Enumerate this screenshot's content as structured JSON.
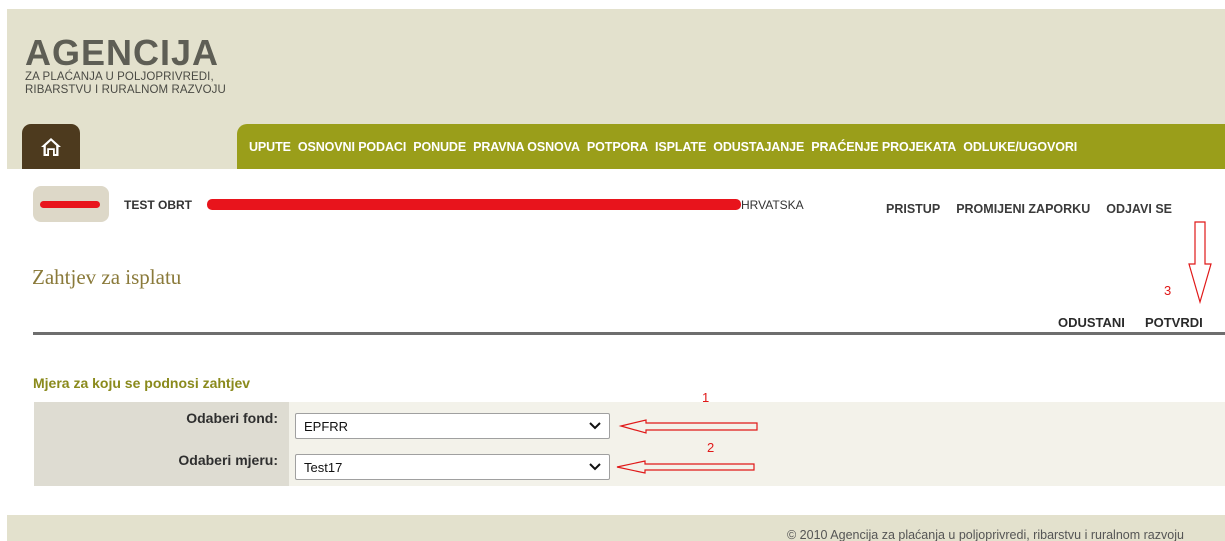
{
  "logo": {
    "title": "AGENCIJA",
    "subtitle_line1": "ZA PLAĆANJA U POLJOPRIVREDI,",
    "subtitle_line2": "RIBARSTVU I RURALNOM RAZVOJU"
  },
  "nav": {
    "home_icon": "home-icon",
    "items": [
      "UPUTE",
      "OSNOVNI PODACI",
      "PONUDE",
      "PRAVNA OSNOVA",
      "POTPORA",
      "ISPLATE",
      "ODUSTAJANJE",
      "PRAĆENJE PROJEKATA",
      "ODLUKE/UGOVORI"
    ]
  },
  "user": {
    "name": "TEST OBRT",
    "country": "HRVATSKA",
    "links": [
      "PRISTUP",
      "PROMIJENI ZAPORKU",
      "ODJAVI SE"
    ]
  },
  "page": {
    "title": "Zahtjev za isplatu",
    "actions": [
      "ODUSTANI",
      "POTVRDI"
    ]
  },
  "form": {
    "heading": "Mjera za koju se podnosi zahtjev",
    "fields": [
      {
        "label": "Odaberi fond:",
        "value": "EPFRR"
      },
      {
        "label": "Odaberi mjeru:",
        "value": "Test17"
      }
    ]
  },
  "annotations": [
    "1",
    "2",
    "3"
  ],
  "footer": {
    "text": "© 2010 Agencija za plaćanja u poljoprivredi, ribarstvu i ruralnom razvoju"
  },
  "colors": {
    "nav_bg": "#9a9e1a",
    "home_bg": "#4d3a1e",
    "page_bg": "#e3e1cd",
    "title": "#8a7a3a",
    "redaction": "#e8141c",
    "annotation": "#e01818"
  }
}
